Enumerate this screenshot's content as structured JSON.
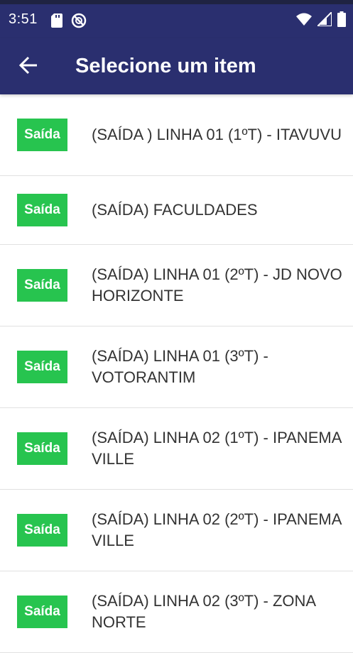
{
  "status_bar": {
    "time": "3:51",
    "icons": [
      "sd-card-icon",
      "do-not-disturb-icon",
      "wifi-icon",
      "cell-signal-icon",
      "battery-icon"
    ]
  },
  "app_bar": {
    "title": "Selecione um item",
    "back_icon": "arrow-back-icon",
    "background_color": "#2a2f6f"
  },
  "items": [
    {
      "badge": "Saída",
      "text": "(SAÍDA ) LINHA 01 (1ºT) - ITAVUVU"
    },
    {
      "badge": "Saída",
      "text": "(SAÍDA) FACULDADES"
    },
    {
      "badge": "Saída",
      "text": "(SAÍDA) LINHA 01 (2ºT) - JD NOVO HORIZONTE"
    },
    {
      "badge": "Saída",
      "text": "(SAÍDA) LINHA 01 (3ºT) - VOTORANTIM"
    },
    {
      "badge": "Saída",
      "text": "(SAÍDA) LINHA 02 (1ºT) - IPANEMA VILLE"
    },
    {
      "badge": "Saída",
      "text": "(SAÍDA) LINHA 02 (2ºT) - IPANEMA VILLE"
    },
    {
      "badge": "Saída",
      "text": "(SAÍDA) LINHA 02 (3ºT) - ZONA NORTE"
    }
  ],
  "colors": {
    "badge_green": "#27c44f",
    "text": "#333333"
  }
}
